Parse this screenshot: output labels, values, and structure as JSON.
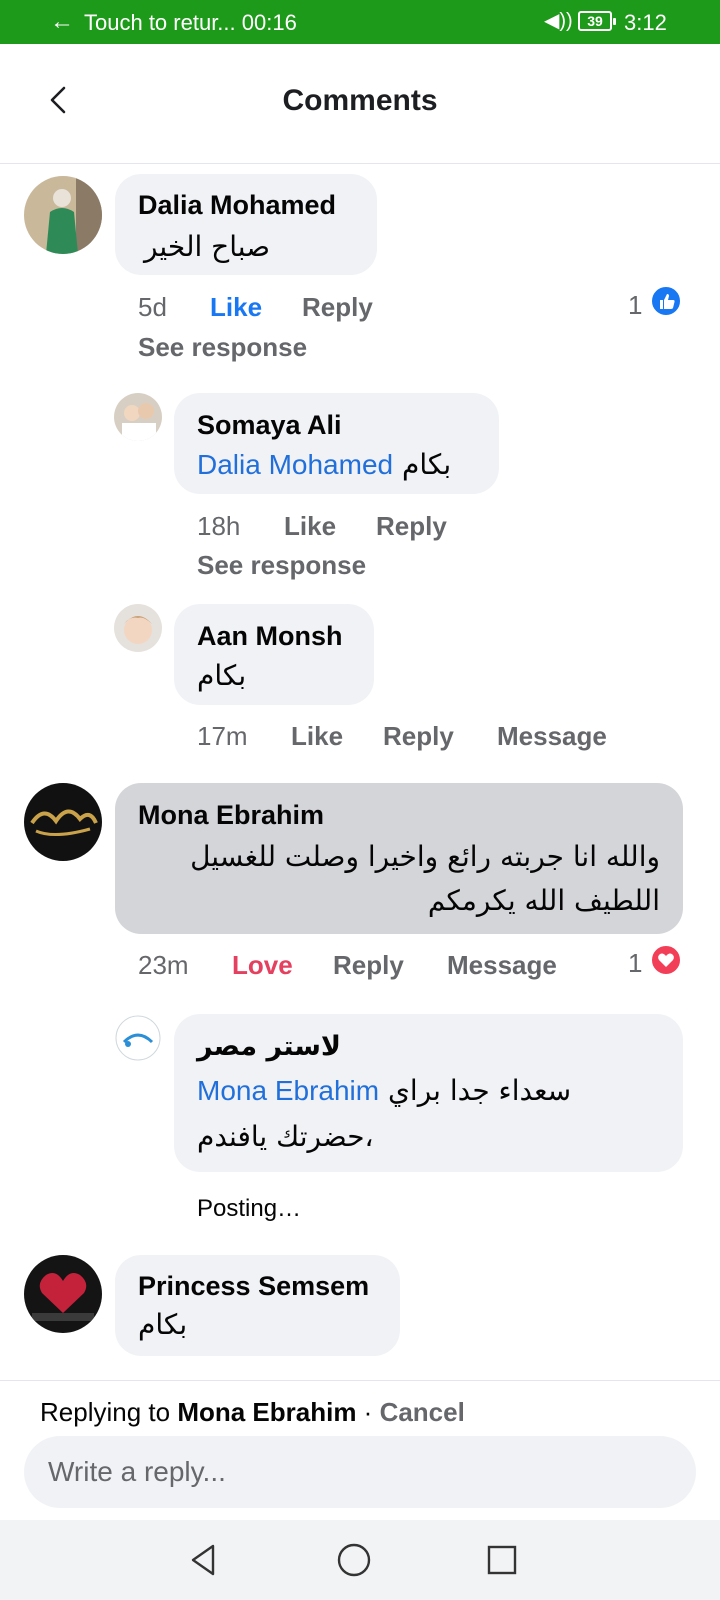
{
  "status_bar": {
    "call_text": "Touch to retur... 00:16",
    "battery": "39",
    "time": "3:12",
    "bg_color": "#1e9a1a"
  },
  "header": {
    "title": "Comments"
  },
  "comments": [
    {
      "author": "Dalia Mohamed",
      "text": "صباح الخير",
      "time": "5d",
      "like_label": "Like",
      "reply_label": "Reply",
      "reaction_count": "1",
      "reaction_icon": "like-icon",
      "see_response": "See response"
    },
    {
      "author": "Somaya Ali",
      "mention": "Dalia Mohamed",
      "text": "بكام",
      "time": "18h",
      "like_label": "Like",
      "reply_label": "Reply",
      "see_response": "See response"
    },
    {
      "author": "Aan Monsh",
      "text": "بكام",
      "time": "17m",
      "like_label": "Like",
      "reply_label": "Reply",
      "message_label": "Message"
    },
    {
      "author": "Mona Ebrahim",
      "text_line1": "والله انا جربته رائع واخيرا وصلت للغسيل",
      "text_line2": "اللطيف الله يكرمكم",
      "time": "23m",
      "love_label": "Love",
      "reply_label": "Reply",
      "message_label": "Message",
      "reaction_count": "1",
      "reaction_icon": "love-icon"
    },
    {
      "author": "لاستر مصر",
      "mention": "Mona Ebrahim",
      "text_line1": "سعداء جدا براي",
      "text_line2": "حضرتك يافندم،",
      "status": "Posting…"
    },
    {
      "author": "Princess Semsem",
      "text": "بكام"
    }
  ],
  "reply_box": {
    "prefix": "Replying to",
    "target": "Mona Ebrahim",
    "separator": " · ",
    "cancel": "Cancel",
    "placeholder": "Write a reply..."
  },
  "colors": {
    "link_blue": "#1877f2",
    "love_red": "#e4405f",
    "bubble_gray": "#f0f2f5"
  }
}
